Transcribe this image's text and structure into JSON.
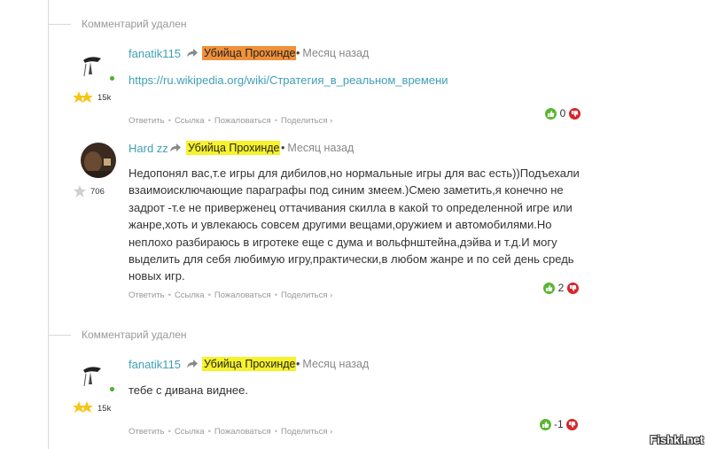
{
  "deleted_top": "Комментарий удален",
  "deleted_mid": "Комментарий удален",
  "comments": [
    {
      "author": "fanatik115",
      "reply_to": "Убийца Прохиндея",
      "time": "Месяц назад",
      "link": "https://ru.wikipedia.org/wiki/Стратегия_в_реальном_времени",
      "karma": "15k",
      "votes": "0",
      "actions": [
        "Ответить",
        "Ссылка",
        "Пожаловаться",
        "Поделиться ›"
      ]
    },
    {
      "author": "Hard zz",
      "reply_to": "Убийца Прохиндея",
      "time": "Месяц назад",
      "text_lines": [
        "Недопонял вас,т.е игры для дибилов,но нормальные игры для вас есть))Подъехали",
        "взаимоисключающие параграфы под синим змеем.)Смею заметить,я конечно не",
        "задрот -т.е не приверженец оттачивания скилла в какой то определенной игре или",
        "жанре,хоть и увлекаюсь совсем другими вещами,оружием и автомобилями.Но",
        "неплохо разбираюсь в игротеке еще с дума и вольфнштейна,дэйва и т.д.И могу",
        "выделить для себя любимую игру,практически,в любом жанре и по сей день средь",
        "новых игр."
      ],
      "karma": "706",
      "votes": "2",
      "actions": [
        "Ответить",
        "Ссылка",
        "Пожаловаться",
        "Поделиться ›"
      ]
    },
    {
      "author": "fanatik115",
      "reply_to": "Убийца Прохиндея",
      "time": "Месяц назад",
      "text": "тебе с дивана виднее.",
      "karma": "15k",
      "votes": "-1",
      "actions": [
        "Ответить",
        "Ссылка",
        "Пожаловаться",
        "Поделиться ›"
      ]
    }
  ],
  "watermark": "Fishki.net",
  "colors": {
    "author": "#3fa0b5",
    "orange_highlight": "#f0913a",
    "yellow_highlight": "#f7f22a",
    "vote_up": "#5bb631",
    "vote_down": "#d8252c"
  }
}
